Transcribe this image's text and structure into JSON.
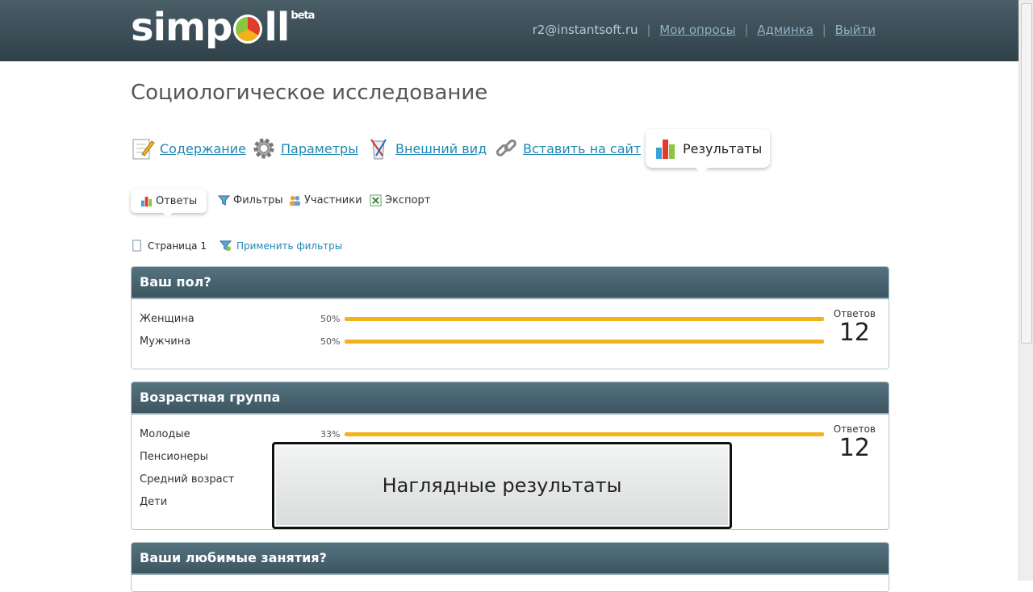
{
  "header": {
    "logo": "simpoll",
    "logo_badge": "beta",
    "email": "r2@instantsoft.ru",
    "links": [
      "Мои опросы",
      "Админка",
      "Выйти"
    ]
  },
  "page_title": "Социологическое исследование",
  "tabs": [
    {
      "label": "Содержание",
      "icon": "edit-icon"
    },
    {
      "label": "Параметры",
      "icon": "gear-icon"
    },
    {
      "label": "Внешний вид",
      "icon": "design-icon"
    },
    {
      "label": "Вставить на сайт",
      "icon": "link-icon"
    },
    {
      "label": "Результаты",
      "icon": "chart-icon",
      "active": true
    }
  ],
  "subtabs": [
    {
      "label": "Ответы",
      "icon": "chart-icon",
      "active": true
    },
    {
      "label": "Фильтры",
      "icon": "filter-icon"
    },
    {
      "label": "Участники",
      "icon": "users-icon"
    },
    {
      "label": "Экспорт",
      "icon": "excel-icon"
    }
  ],
  "page_nav": {
    "page_label": "Страница 1",
    "apply_filters": "Применить фильтры"
  },
  "questions": [
    {
      "title": "Ваш пол?",
      "answers_label": "Ответов",
      "answers_count": "12",
      "options": [
        {
          "label": "Женщина",
          "percent": "50%",
          "value": 0.5
        },
        {
          "label": "Мужчина",
          "percent": "50%",
          "value": 0.5
        }
      ]
    },
    {
      "title": "Возрастная группа",
      "answers_label": "Ответов",
      "answers_count": "12",
      "options": [
        {
          "label": "Молодые",
          "percent": "33%",
          "value": 0.33
        },
        {
          "label": "Пенсионеры"
        },
        {
          "label": "Средний возраст"
        },
        {
          "label": "Дети"
        }
      ]
    },
    {
      "title": "Ваши любимые занятия?"
    }
  ],
  "overlay_caption": "Наглядные результаты",
  "colors": {
    "header_bg": "#3a4d57",
    "bar": "#f2b21c",
    "link": "#1f87b4",
    "panel_header": "#4a6673"
  }
}
